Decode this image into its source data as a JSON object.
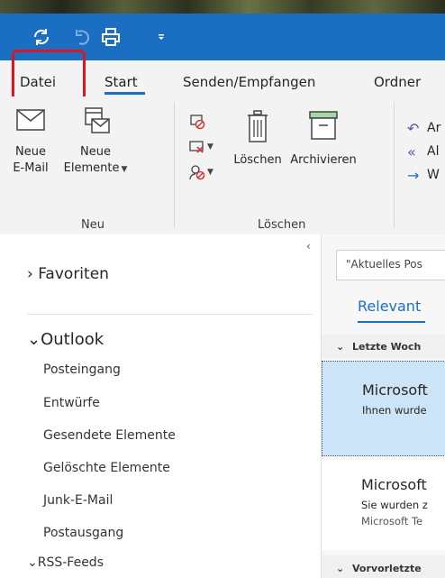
{
  "titlebar": {
    "bg": "#1a6fc3"
  },
  "menu": {
    "tabs": [
      "Datei",
      "Start",
      "Senden/Empfangen",
      "Ordner"
    ],
    "active": "Start",
    "highlight_color": "#e0141e"
  },
  "ribbon": {
    "neu": {
      "new_email": [
        "Neue",
        "E-Mail"
      ],
      "new_items": [
        "Neue",
        "Elemente"
      ],
      "group": "Neu"
    },
    "loeschen": {
      "delete": "Löschen",
      "archive": "Archivieren",
      "group": "Löschen"
    },
    "reply": {
      "items": [
        "Ar",
        "Al",
        "W"
      ]
    }
  },
  "folders": {
    "favorites": "Favoriten",
    "account": "Outlook",
    "items": [
      "Posteingang",
      "Entwürfe",
      "Gesendete Elemente",
      "Gelöschte Elemente",
      "Junk-E-Mail",
      "Postausgang"
    ],
    "rss": "RSS-Feeds"
  },
  "messages": {
    "search_placeholder": "\"Aktuelles Pos",
    "filter_tab": "Relevant",
    "group1": "Letzte Woch",
    "group2": "Vorvorletzte",
    "mail1": {
      "sender": "Microsoft",
      "preview": "Ihnen wurde"
    },
    "mail2": {
      "sender": "Microsoft",
      "preview": "Sie wurden z",
      "preview2": "Microsoft Te"
    }
  },
  "icons": [
    "sync-icon",
    "undo-icon",
    "print-icon",
    "qat-dropdown-icon",
    "new-mail-icon",
    "new-items-icon",
    "ignore-icon",
    "cleanup-icon",
    "junk-icon",
    "delete-icon",
    "archive-icon",
    "reply-icon",
    "reply-all-icon",
    "forward-icon"
  ]
}
